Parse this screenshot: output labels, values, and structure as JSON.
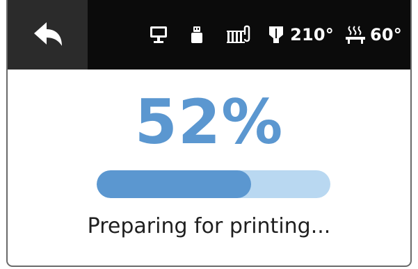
{
  "topbar": {
    "back_icon": "back-arrow-icon",
    "status_icons": [
      "monitor-icon",
      "usb-stick-icon",
      "enclosure-heater-icon",
      "nozzle-icon",
      "heated-bed-icon"
    ],
    "nozzle_temp": "210°",
    "bed_temp": "60°"
  },
  "progress": {
    "percent_label": "52%",
    "value": 0.66,
    "status_text": "Preparing for printing..."
  },
  "colors": {
    "accent": "#5b97d0",
    "track": "#b9d8f1",
    "topbar": "#0b0b0b",
    "back_button": "#2b2b2b"
  }
}
